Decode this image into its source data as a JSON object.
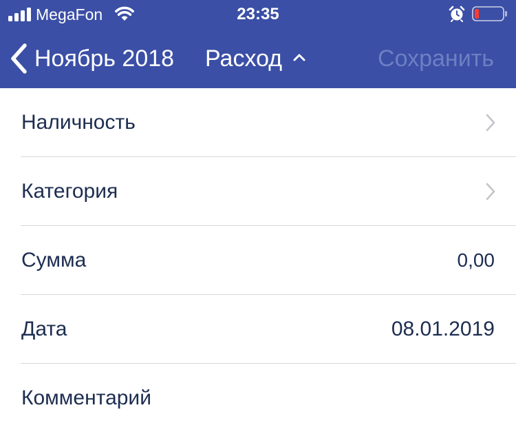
{
  "status_bar": {
    "carrier": "MegaFon",
    "time": "23:35",
    "signal_icon": "cellular-signal-icon",
    "wifi_icon": "wifi-icon",
    "alarm_icon": "alarm-clock-icon",
    "battery_icon": "battery-low-icon",
    "battery_level_color": "#ff3b30"
  },
  "nav": {
    "back_label": "Ноябрь 2018",
    "back_icon": "chevron-left-icon",
    "title": "Расход",
    "title_icon": "caret-up-icon",
    "save_label": "Сохранить"
  },
  "colors": {
    "header_bg": "#3b4fa6",
    "text_primary": "#1d2d50",
    "save_disabled": "#6d7fc4",
    "separator": "#d7d7dc",
    "chevron": "#c4c4c9"
  },
  "form": {
    "rows": [
      {
        "label": "Наличность",
        "value": "",
        "disclosure": true
      },
      {
        "label": "Категория",
        "value": "",
        "disclosure": true
      },
      {
        "label": "Сумма",
        "value": "0,00",
        "disclosure": false
      },
      {
        "label": "Дата",
        "value": "08.01.2019",
        "disclosure": false
      },
      {
        "label": "Комментарий",
        "value": "",
        "disclosure": false
      }
    ]
  }
}
